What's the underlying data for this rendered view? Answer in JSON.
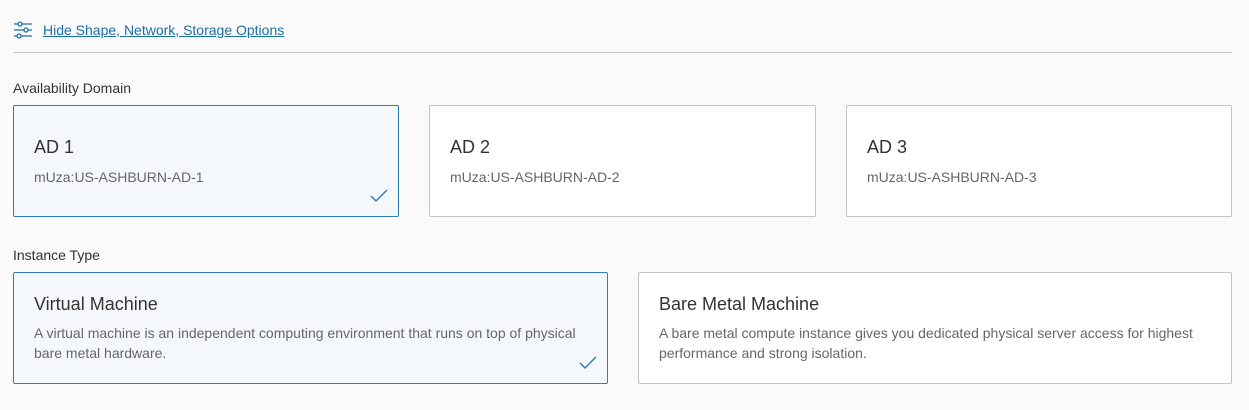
{
  "options_toggle": {
    "label": "Hide Shape, Network, Storage Options",
    "icon": "sliders-icon"
  },
  "availability_domain": {
    "label": "Availability Domain",
    "options": [
      {
        "title": "AD 1",
        "subtitle": "mUza:US-ASHBURN-AD-1",
        "selected": true
      },
      {
        "title": "AD 2",
        "subtitle": "mUza:US-ASHBURN-AD-2",
        "selected": false
      },
      {
        "title": "AD 3",
        "subtitle": "mUza:US-ASHBURN-AD-3",
        "selected": false
      }
    ]
  },
  "instance_type": {
    "label": "Instance Type",
    "options": [
      {
        "title": "Virtual Machine",
        "description": "A virtual machine is an independent computing environment that runs on top of physical bare metal hardware.",
        "selected": true
      },
      {
        "title": "Bare Metal Machine",
        "description": "A bare metal compute instance gives you dedicated physical server access for highest performance and strong isolation.",
        "selected": false
      }
    ]
  },
  "colors": {
    "accent": "#2c7fb8",
    "link": "#1b6fa8",
    "selected_bg": "#f4f8fb"
  }
}
